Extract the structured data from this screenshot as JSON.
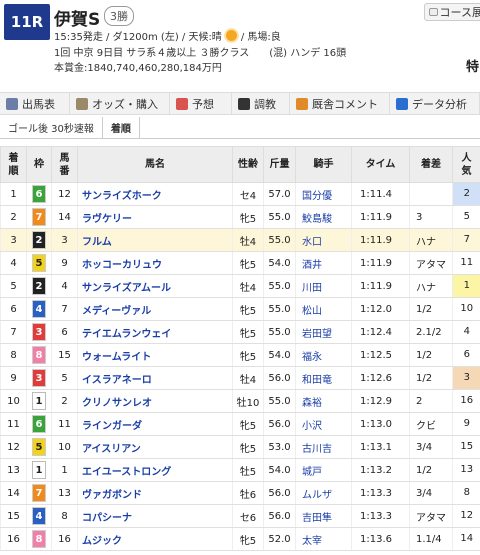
{
  "header": {
    "race_no": "11R",
    "race_name": "伊賀S",
    "race_class": "3勝",
    "course_button": "コース展",
    "start_info": "15:35発走 / ダ1200m (左) / 天候:晴",
    "track_info": "/ 馬場:良",
    "meeting_info": "1回 中京 9日目 サラ系４歳以上 ３勝クラス　　(混) ハンデ 16頭",
    "prize_info": "本賞金:1840,740,460,280,184万円",
    "right_text": "特"
  },
  "nav": [
    {
      "label": "出馬表",
      "icon": "list-icon",
      "color": "#6a7ea8"
    },
    {
      "label": "オッズ・購入",
      "icon": "odds-icon",
      "color": "#9b8a6a"
    },
    {
      "label": "予想",
      "icon": "target-icon",
      "color": "#d9534f"
    },
    {
      "label": "調教",
      "icon": "stopwatch-icon",
      "color": "#333333"
    },
    {
      "label": "厩舎コメント",
      "icon": "comment-icon",
      "color": "#e08a2a"
    },
    {
      "label": "データ分析",
      "icon": "chart-icon",
      "color": "#2a6fd0"
    }
  ],
  "subtabs": [
    {
      "label": "ゴール後 30秒速報",
      "active": false
    },
    {
      "label": "着順",
      "active": true
    }
  ],
  "columns": [
    "着順",
    "枠",
    "馬番",
    "馬名",
    "性齢",
    "斤量",
    "騎手",
    "タイム",
    "着差",
    "人気"
  ],
  "waku_colors": {
    "1": {
      "bg": "#ffffff",
      "fg": "#222222"
    },
    "2": {
      "bg": "#222222",
      "fg": "#ffffff"
    },
    "3": {
      "bg": "#e03c3c",
      "fg": "#ffffff"
    },
    "4": {
      "bg": "#2a5fc4",
      "fg": "#ffffff"
    },
    "5": {
      "bg": "#f2d21b",
      "fg": "#222222"
    },
    "6": {
      "bg": "#3aa33a",
      "fg": "#ffffff"
    },
    "7": {
      "bg": "#f08a1c",
      "fg": "#ffffff"
    },
    "8": {
      "bg": "#f27fa7",
      "fg": "#ffffff"
    }
  },
  "popularity_colors": {
    "1": "#fdf5a6",
    "2": "#cfe0f7",
    "3": "#f5d9b6"
  },
  "highlight_row": 2,
  "rows": [
    {
      "rank": "1",
      "waku": "6",
      "num": "12",
      "name": "サンライズホーク",
      "sex_age": "セ4",
      "weight": "57.0",
      "jockey": "国分優",
      "time": "1:11.4",
      "margin": "",
      "pop": "2"
    },
    {
      "rank": "2",
      "waku": "7",
      "num": "14",
      "name": "ラヴケリー",
      "sex_age": "牝5",
      "weight": "55.0",
      "jockey": "鮫島駿",
      "time": "1:11.9",
      "margin": "3",
      "pop": "5"
    },
    {
      "rank": "3",
      "waku": "2",
      "num": "3",
      "name": "フルム",
      "sex_age": "牡4",
      "weight": "55.0",
      "jockey": "水口",
      "time": "1:11.9",
      "margin": "ハナ",
      "pop": "7"
    },
    {
      "rank": "4",
      "waku": "5",
      "num": "9",
      "name": "ホッコーカリュウ",
      "sex_age": "牝5",
      "weight": "54.0",
      "jockey": "酒井",
      "time": "1:11.9",
      "margin": "アタマ",
      "pop": "11"
    },
    {
      "rank": "5",
      "waku": "2",
      "num": "4",
      "name": "サンライズアムール",
      "sex_age": "牡4",
      "weight": "55.0",
      "jockey": "川田",
      "time": "1:11.9",
      "margin": "ハナ",
      "pop": "1"
    },
    {
      "rank": "6",
      "waku": "4",
      "num": "7",
      "name": "メディーヴァル",
      "sex_age": "牝5",
      "weight": "55.0",
      "jockey": "松山",
      "time": "1:12.0",
      "margin": "1/2",
      "pop": "10"
    },
    {
      "rank": "7",
      "waku": "3",
      "num": "6",
      "name": "テイエムランウェイ",
      "sex_age": "牝5",
      "weight": "55.0",
      "jockey": "岩田望",
      "time": "1:12.4",
      "margin": "2.1/2",
      "pop": "4"
    },
    {
      "rank": "8",
      "waku": "8",
      "num": "15",
      "name": "ウォームライト",
      "sex_age": "牝5",
      "weight": "54.0",
      "jockey": "福永",
      "time": "1:12.5",
      "margin": "1/2",
      "pop": "6"
    },
    {
      "rank": "9",
      "waku": "3",
      "num": "5",
      "name": "イスラアネーロ",
      "sex_age": "牡4",
      "weight": "56.0",
      "jockey": "和田竜",
      "time": "1:12.6",
      "margin": "1/2",
      "pop": "3"
    },
    {
      "rank": "10",
      "waku": "1",
      "num": "2",
      "name": "クリノサンレオ",
      "sex_age": "牡10",
      "weight": "55.0",
      "jockey": "森裕",
      "time": "1:12.9",
      "margin": "2",
      "pop": "16"
    },
    {
      "rank": "11",
      "waku": "6",
      "num": "11",
      "name": "ラインガーダ",
      "sex_age": "牝5",
      "weight": "56.0",
      "jockey": "小沢",
      "time": "1:13.0",
      "margin": "クビ",
      "pop": "9"
    },
    {
      "rank": "12",
      "waku": "5",
      "num": "10",
      "name": "アイスリアン",
      "sex_age": "牝5",
      "weight": "53.0",
      "jockey": "古川吉",
      "time": "1:13.1",
      "margin": "3/4",
      "pop": "15"
    },
    {
      "rank": "13",
      "waku": "1",
      "num": "1",
      "name": "エイユーストロング",
      "sex_age": "牡5",
      "weight": "54.0",
      "jockey": "城戸",
      "time": "1:13.2",
      "margin": "1/2",
      "pop": "13"
    },
    {
      "rank": "14",
      "waku": "7",
      "num": "13",
      "name": "ヴァガボンド",
      "sex_age": "牡6",
      "weight": "56.0",
      "jockey": "ムルザ",
      "time": "1:13.3",
      "margin": "3/4",
      "pop": "8"
    },
    {
      "rank": "15",
      "waku": "4",
      "num": "8",
      "name": "コパシーナ",
      "sex_age": "セ6",
      "weight": "56.0",
      "jockey": "吉田隼",
      "time": "1:13.3",
      "margin": "アタマ",
      "pop": "12"
    },
    {
      "rank": "16",
      "waku": "8",
      "num": "16",
      "name": "ムジック",
      "sex_age": "牝5",
      "weight": "52.0",
      "jockey": "太宰",
      "time": "1:13.6",
      "margin": "1.1/4",
      "pop": "14"
    }
  ]
}
